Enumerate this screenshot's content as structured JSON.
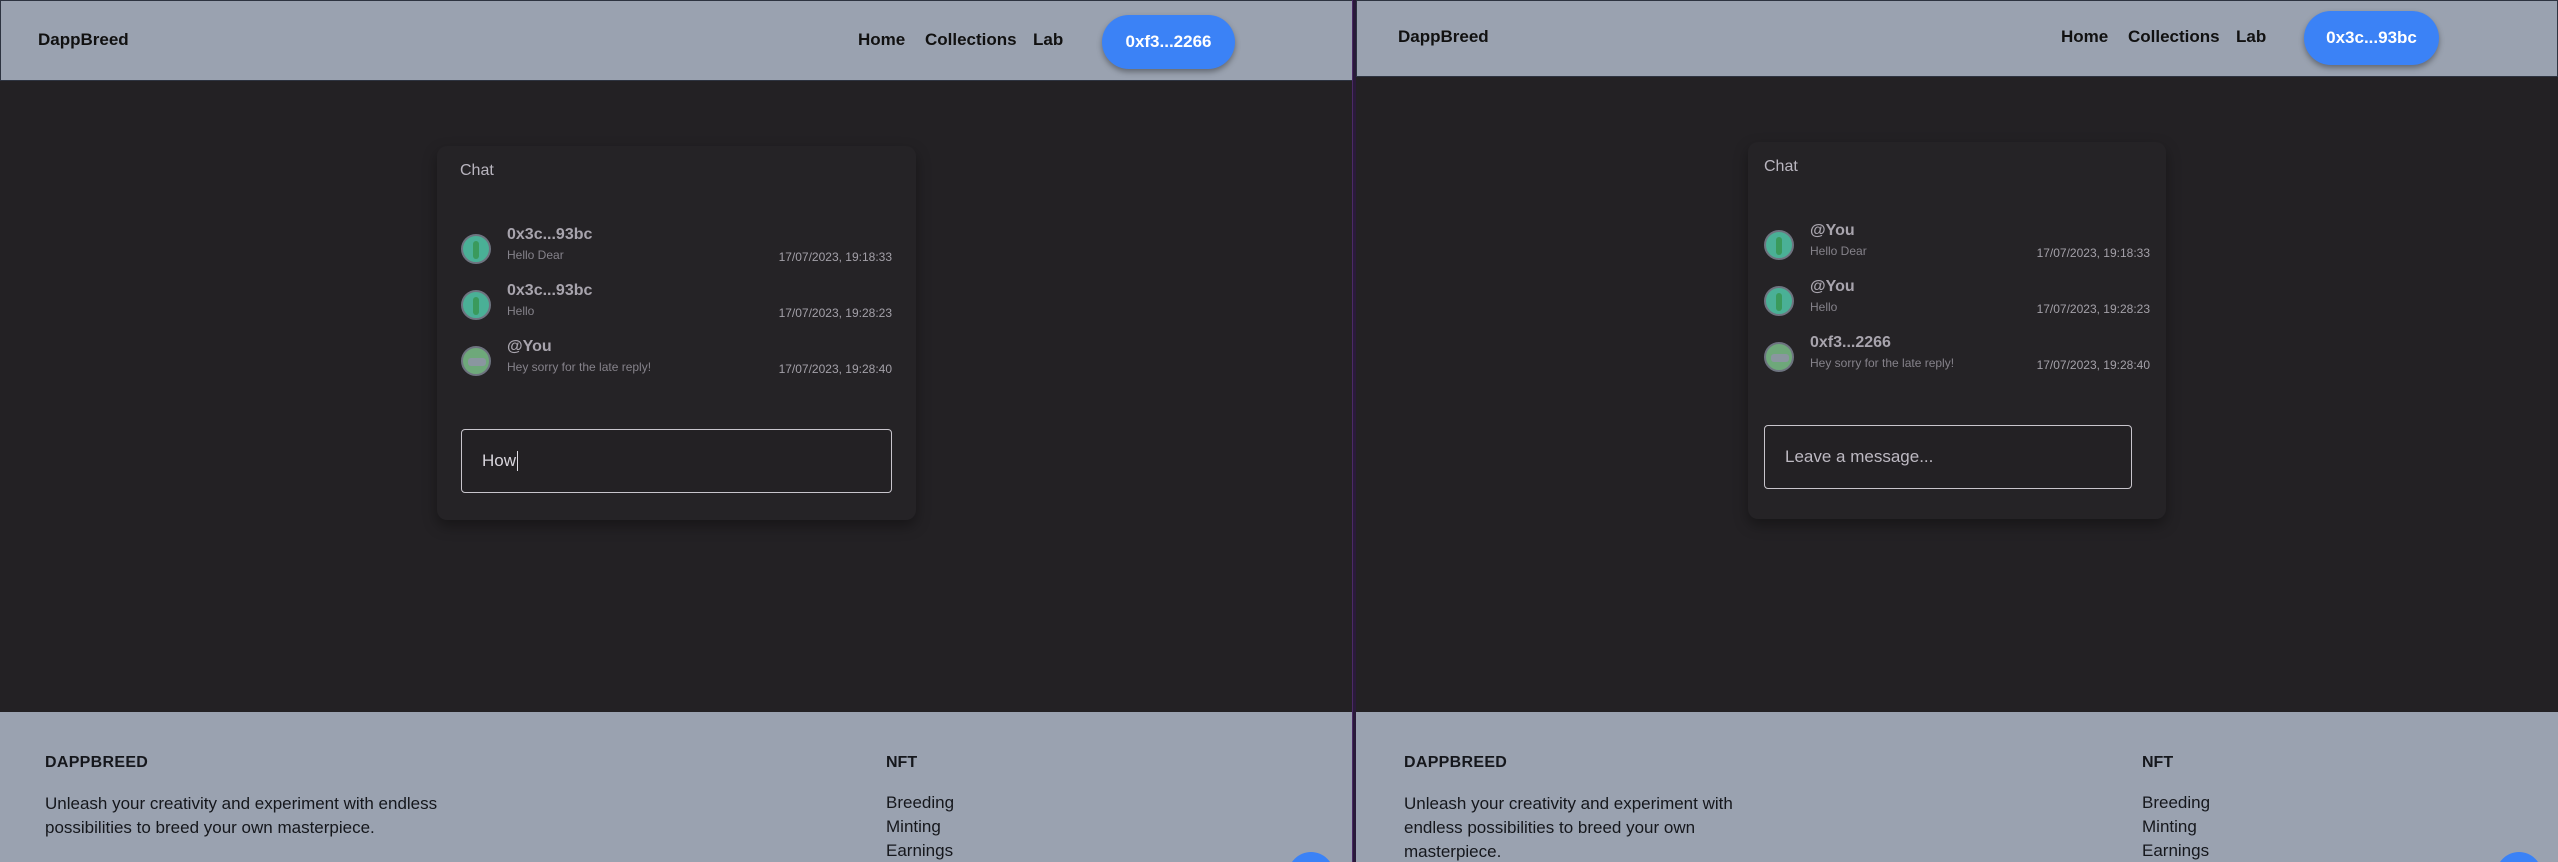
{
  "left": {
    "brand": "DappBreed",
    "nav": [
      "Home",
      "Collections",
      "Lab"
    ],
    "wallet": "0xf3...2266",
    "chat": {
      "title": "Chat",
      "messages": [
        {
          "name": "0x3c...93bc",
          "text": "Hello Dear",
          "time": "17/07/2023, 19:18:33"
        },
        {
          "name": "0x3c...93bc",
          "text": "Hello",
          "time": "17/07/2023, 19:28:23"
        },
        {
          "name": "@You",
          "text": "Hey sorry for the late reply!",
          "time": "17/07/2023, 19:28:40"
        }
      ],
      "input_value": "How"
    },
    "footer": {
      "brand": "DAPPBREED",
      "tagline_1": "Unleash your creativity and experiment with endless",
      "tagline_2": "possibilities to breed your own masterpiece.",
      "nft_title": "NFT",
      "links": [
        "Breeding",
        "Minting",
        "Earnings"
      ]
    }
  },
  "right": {
    "brand": "DappBreed",
    "nav": [
      "Home",
      "Collections",
      "Lab"
    ],
    "wallet": "0x3c...93bc",
    "chat": {
      "title": "Chat",
      "messages": [
        {
          "name": "@You",
          "text": "Hello Dear",
          "time": "17/07/2023, 19:18:33"
        },
        {
          "name": "@You",
          "text": "Hello",
          "time": "17/07/2023, 19:28:23"
        },
        {
          "name": "0xf3...2266",
          "text": "Hey sorry for the late reply!",
          "time": "17/07/2023, 19:28:40"
        }
      ],
      "input_placeholder": "Leave a message..."
    },
    "footer": {
      "brand": "DAPPBREED",
      "tagline_1": "Unleash your creativity and experiment with",
      "tagline_2": "endless possibilities to breed your own",
      "tagline_3": "masterpiece.",
      "nft_title": "NFT",
      "links": [
        "Breeding",
        "Minting",
        "Earnings"
      ]
    }
  },
  "colors": {
    "header_bg": "#9aa2b0",
    "body_bg": "#232124",
    "accent": "#3b82f6"
  }
}
